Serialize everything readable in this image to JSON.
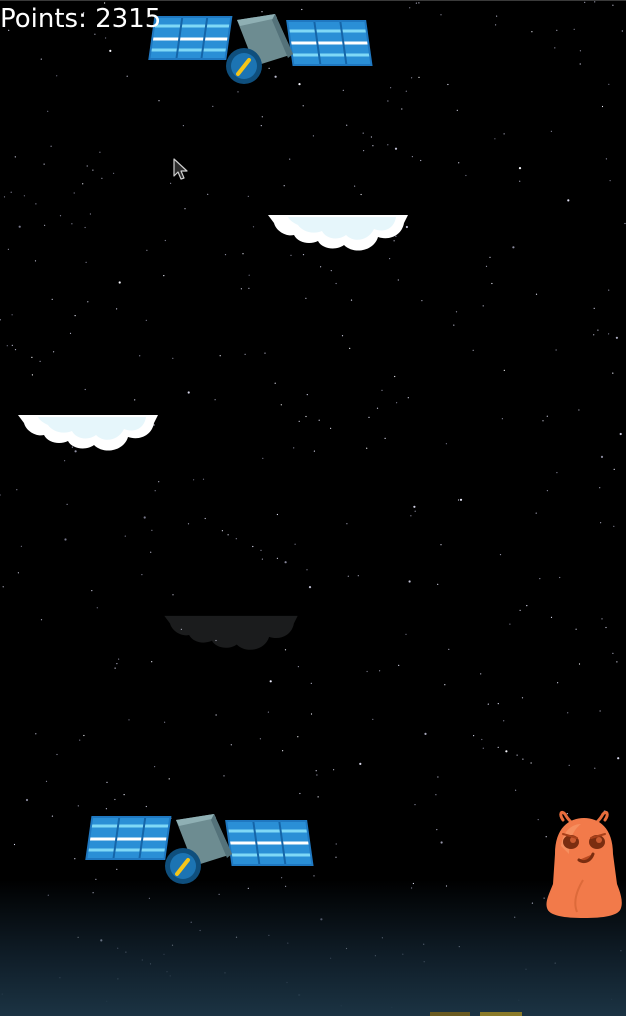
{
  "hud": {
    "points_text": "Points: 2315"
  },
  "icons": {
    "satellite": "satellite-icon",
    "cloud": "cloud-platform-icon",
    "alien": "orange-alien-icon",
    "cursor": "mouse-pointer-icon"
  },
  "colors": {
    "background": "#000000",
    "horizon": "#1b3343",
    "panel_blue": "#2a8fd6",
    "panel_light": "#7fd8f6",
    "satellite_body": "#6d8c91",
    "alien_orange": "#f27a4a",
    "cloud": "#ffffff",
    "hud_text": "#ffffff"
  }
}
